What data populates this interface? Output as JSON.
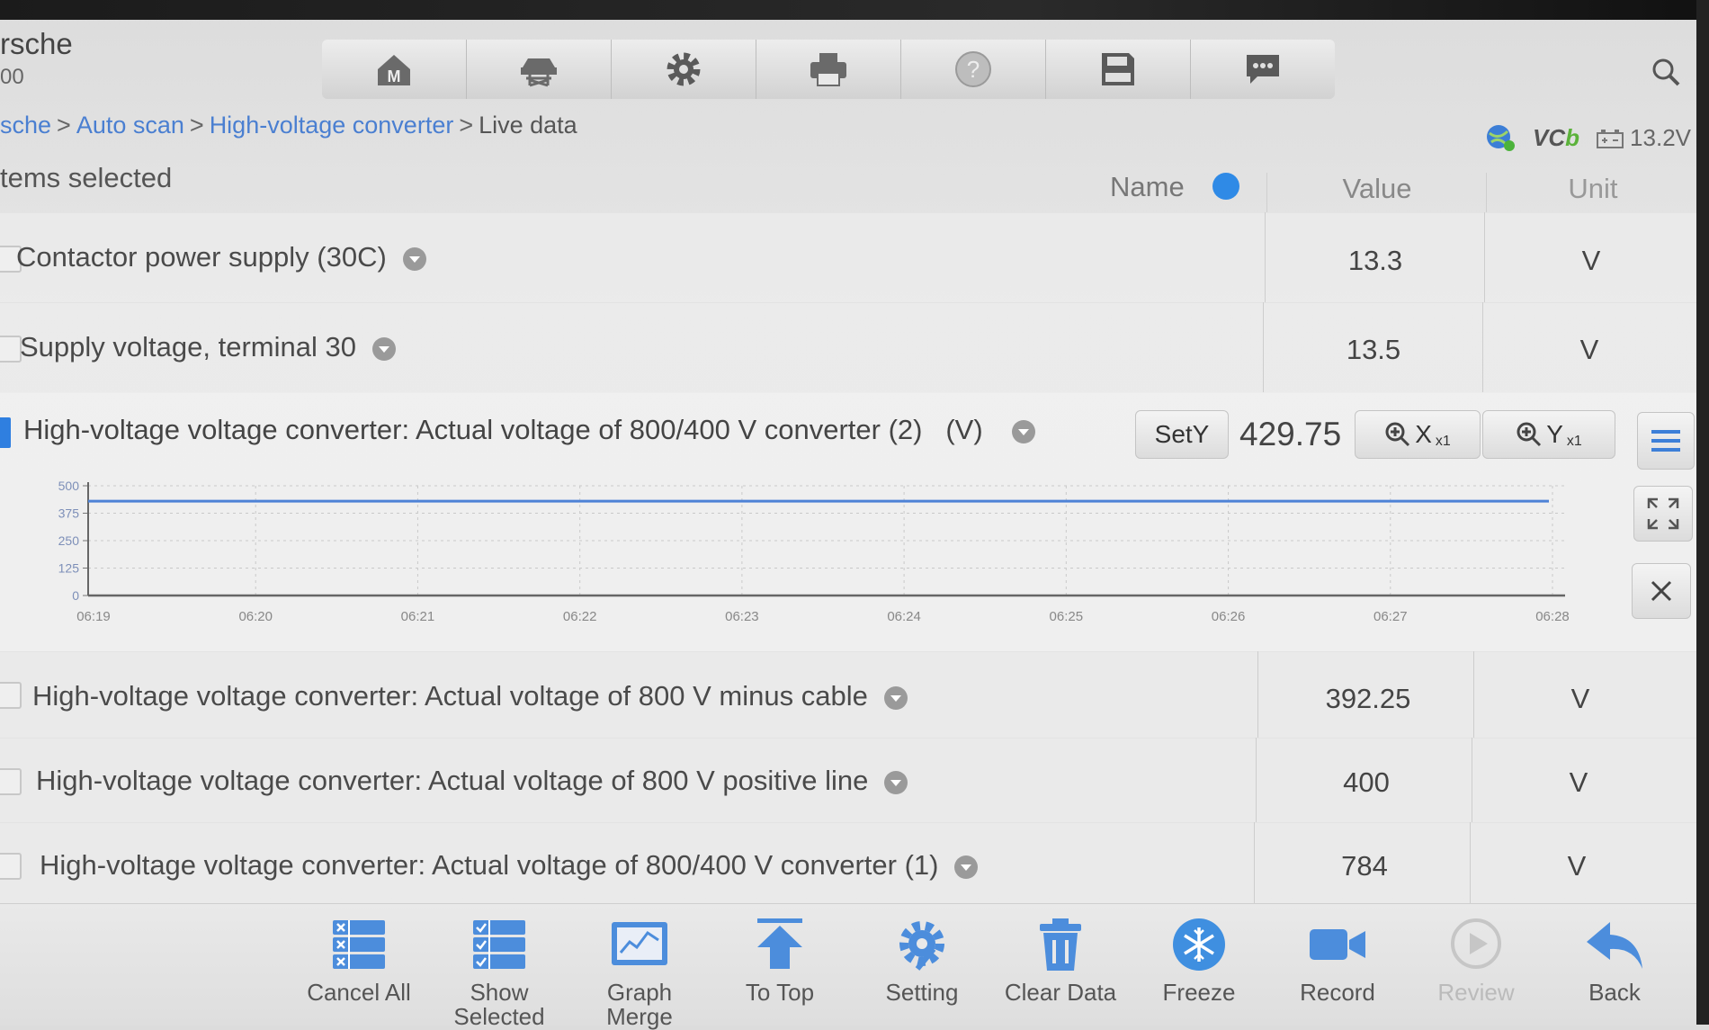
{
  "header": {
    "vehicle_make": "rsche",
    "vehicle_model": "00",
    "toolbar": [
      {
        "name": "home-icon"
      },
      {
        "name": "vehicle-lift-icon"
      },
      {
        "name": "gear-icon"
      },
      {
        "name": "printer-icon"
      },
      {
        "name": "help-icon"
      },
      {
        "name": "save-icon"
      },
      {
        "name": "chat-icon"
      }
    ]
  },
  "breadcrumb": {
    "items": [
      "sche",
      "Auto scan",
      "High-voltage converter"
    ],
    "current": "Live data",
    "separator": ">"
  },
  "status": {
    "vci_label_a": "VC",
    "vci_label_b": "b",
    "voltage": "13.2V"
  },
  "table": {
    "items_selected": "tems selected",
    "col_name": "Name",
    "col_value": "Value",
    "col_unit": "Unit",
    "rows_top": [
      {
        "name": "Contactor power supply (30C)",
        "value": "13.3",
        "unit": "V"
      },
      {
        "name": "Supply voltage, terminal 30",
        "value": "13.5",
        "unit": "V"
      }
    ],
    "graph_item": {
      "name": "High-voltage voltage converter: Actual voltage of 800/400 V converter (2)",
      "unit_label": "(V)",
      "sety_label": "SetY",
      "value": "429.75",
      "zoom_x_label": "X",
      "zoom_x_factor": "x1",
      "zoom_y_label": "Y",
      "zoom_y_factor": "x1"
    },
    "rows_bottom": [
      {
        "name": "High-voltage voltage converter: Actual voltage of 800 V minus cable",
        "value": "392.25",
        "unit": "V"
      },
      {
        "name": "High-voltage voltage converter: Actual voltage of 800 V positive line",
        "value": "400",
        "unit": "V"
      },
      {
        "name": "High-voltage voltage converter: Actual voltage of 800/400 V converter (1)",
        "value": "784",
        "unit": "V"
      }
    ]
  },
  "chart_data": {
    "type": "line",
    "x": [
      "06:19",
      "06:20",
      "06:21",
      "06:22",
      "06:23",
      "06:24",
      "06:25",
      "06:26",
      "06:27",
      "06:28"
    ],
    "y_ticks": [
      0,
      125,
      250,
      375,
      500
    ],
    "ylim": [
      0,
      500
    ],
    "series": [
      {
        "values": [
          430,
          430,
          430,
          430,
          430,
          429.9,
          429.8,
          429.8,
          429.75,
          429.75
        ],
        "color": "#4d82d6"
      }
    ],
    "grid": true
  },
  "bottombar": [
    {
      "label": "Cancel All",
      "icon": "cancel-all-icon"
    },
    {
      "label": "Show Selected",
      "icon": "show-selected-icon"
    },
    {
      "label": "Graph Merge",
      "icon": "graph-merge-icon"
    },
    {
      "label": "To Top",
      "icon": "to-top-icon"
    },
    {
      "label": "Setting",
      "icon": "setting-icon"
    },
    {
      "label": "Clear Data",
      "icon": "trash-icon"
    },
    {
      "label": "Freeze",
      "icon": "snowflake-icon"
    },
    {
      "label": "Record",
      "icon": "video-camera-icon"
    },
    {
      "label": "Review",
      "icon": "play-icon"
    },
    {
      "label": "Back",
      "icon": "back-arrow-icon"
    }
  ],
  "colors": {
    "accent": "#2f8ae6",
    "link": "#4a7fd1",
    "series": "#4d82d6"
  }
}
